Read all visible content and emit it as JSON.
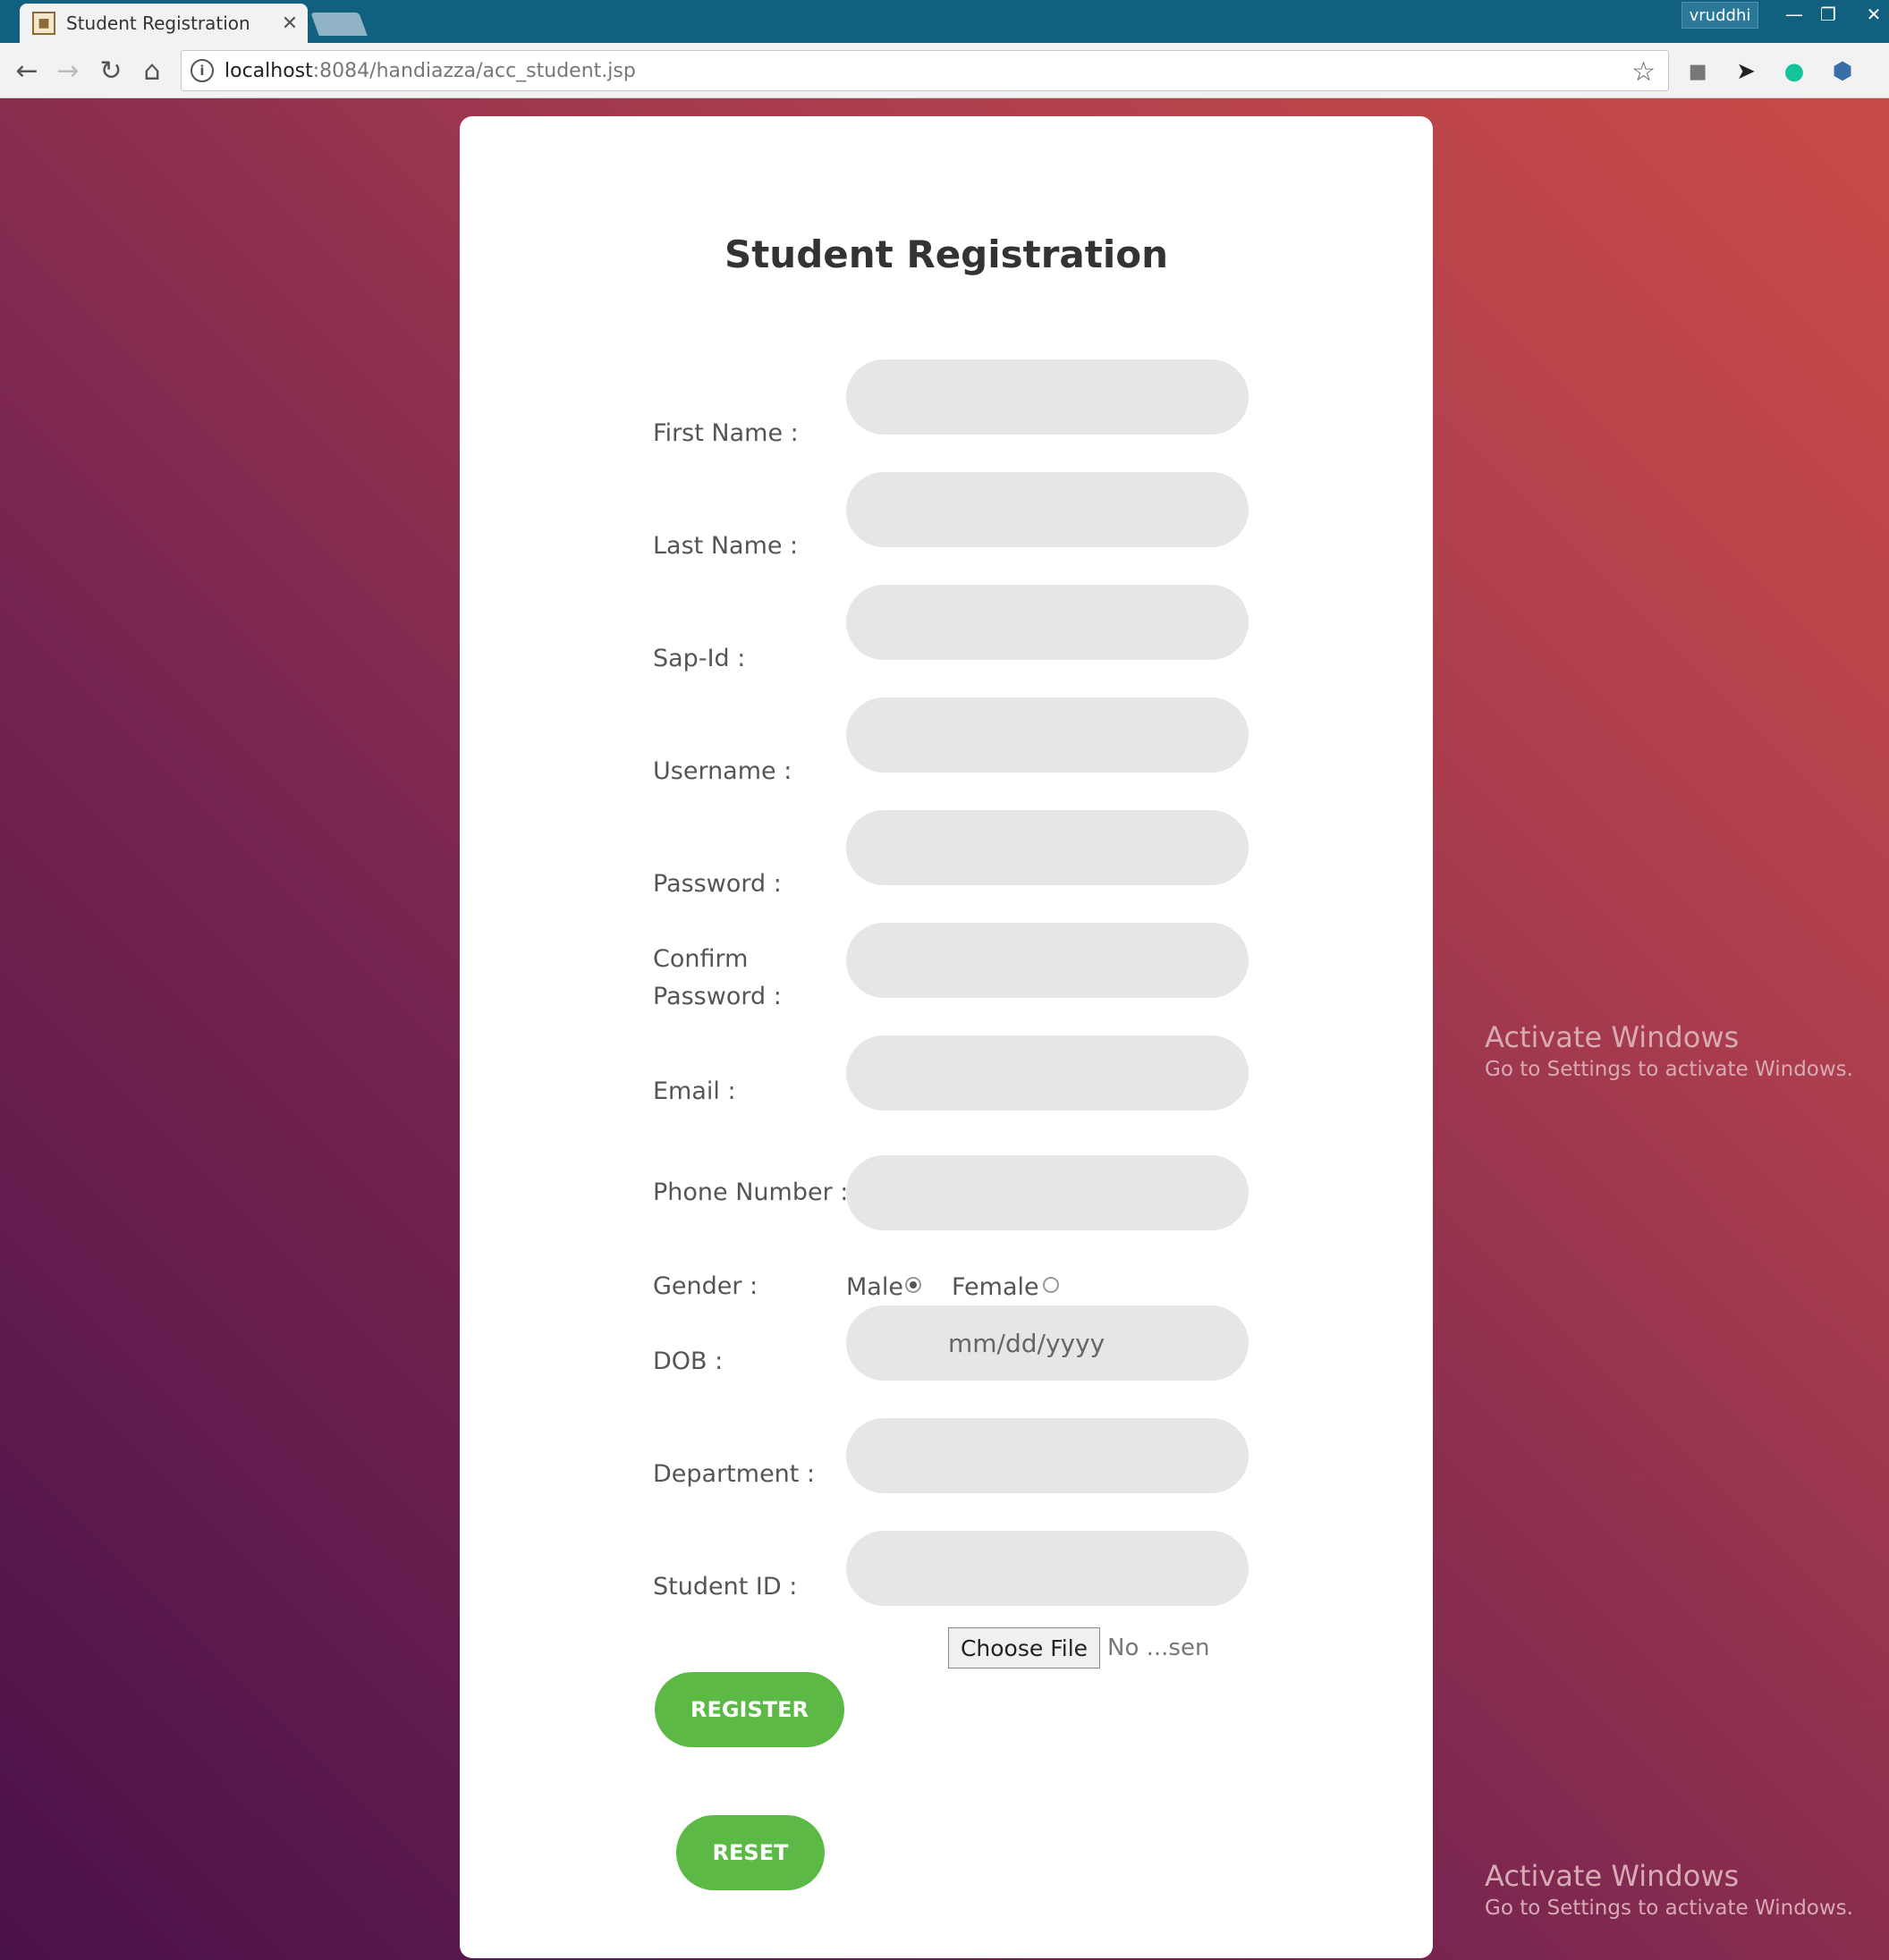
{
  "browser": {
    "tab_title": "Student Registration",
    "url_host": "localhost",
    "url_path": ":8084/handiazza/acc_student.jsp",
    "profile_name": "vruddhi"
  },
  "form": {
    "heading": "Student Registration",
    "labels": {
      "first_name": "First Name :",
      "last_name": "Last Name :",
      "sap_id": "Sap-Id :",
      "username": "Username :",
      "password": "Password :",
      "confirm_line1": "Confirm",
      "confirm_line2": "Password :",
      "email": "Email :",
      "phone": "Phone Number :",
      "gender": "Gender :",
      "dob": "DOB :",
      "department": "Department :",
      "student_id": "Student ID :"
    },
    "gender_options": [
      "Male",
      "Female"
    ],
    "gender_selected": "Male",
    "dob_placeholder": "mm/dd/yyyy",
    "file_button": "Choose File",
    "file_status": "No ...sen",
    "register_label": "REGISTER",
    "reset_label": "RESET"
  },
  "watermark": {
    "title": "Activate Windows",
    "subtitle": "Go to Settings to activate Windows."
  },
  "colors": {
    "title_bar": "#12607f",
    "button_green": "#5cb946",
    "field_bg": "#e6e6e6"
  }
}
